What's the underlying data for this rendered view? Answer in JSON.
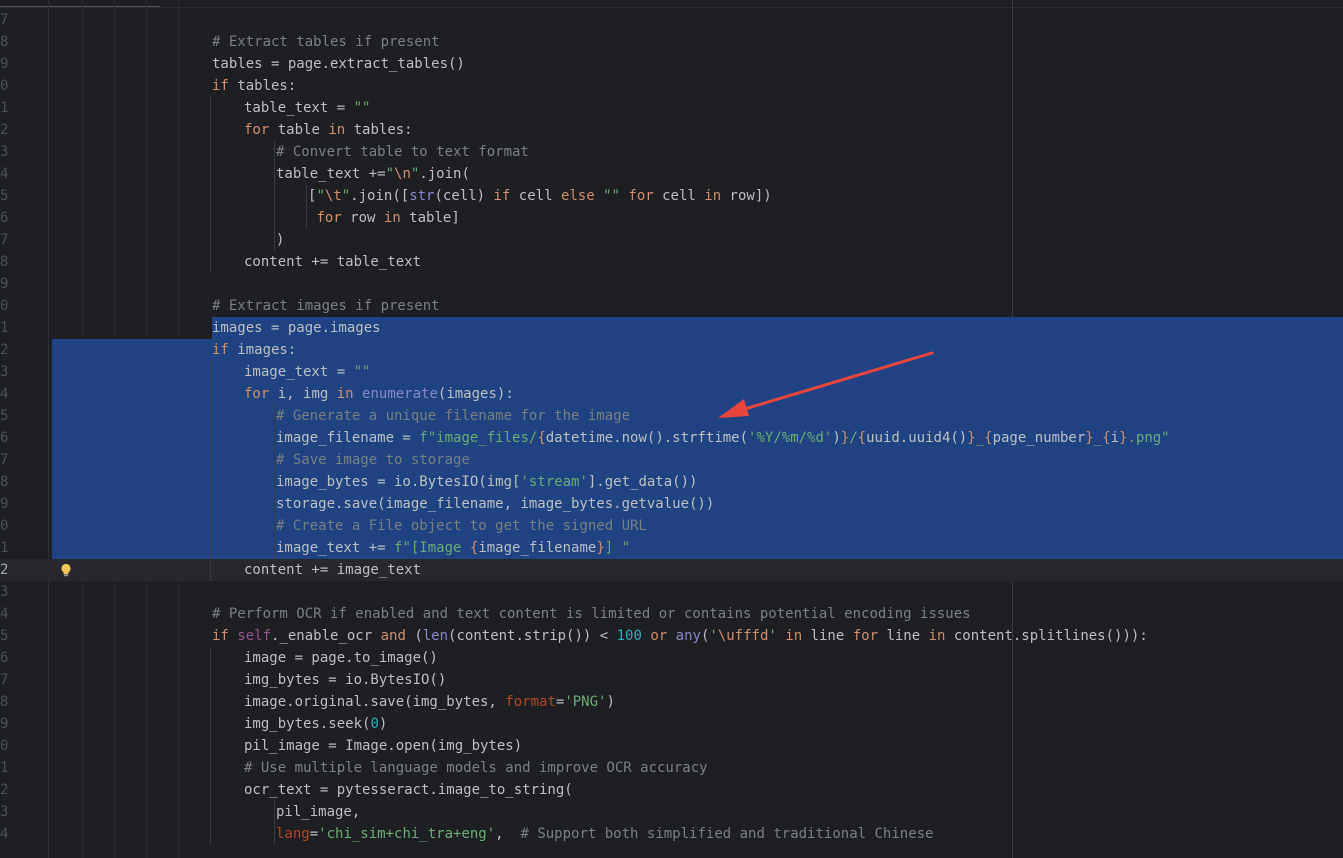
{
  "colors": {
    "background": "#1e1f22",
    "selection": "#214283",
    "current_line": "#26282e",
    "line_number": "#4b5059",
    "keyword": "#cf8e6d",
    "string": "#6aab73",
    "comment": "#7a7e85",
    "number": "#2aacb8",
    "builtin": "#8888c6",
    "self": "#94558d",
    "named_arg": "#aa4926",
    "text": "#bcbec4",
    "escape": "#cf8e6d",
    "arrow": "#e8453c"
  },
  "icons": {
    "intention_bulb": "lightbulb-icon",
    "annotation": "red-arrow"
  },
  "editor": {
    "language": "python",
    "selection_lines": [
      31,
      32
    ],
    "current_line": 42,
    "lines": [
      {
        "n": "7",
        "indent": 0,
        "tokens": []
      },
      {
        "n": "8",
        "indent": 2,
        "tokens": [
          {
            "t": "# Extract tables if present",
            "k": "cm"
          }
        ]
      },
      {
        "n": "9",
        "indent": 2,
        "tokens": [
          {
            "t": "tables = page.extract_tables()",
            "k": ""
          }
        ]
      },
      {
        "n": "0",
        "indent": 2,
        "tokens": [
          {
            "t": "if",
            "k": "kw"
          },
          {
            "t": " tables:",
            "k": ""
          }
        ]
      },
      {
        "n": "1",
        "indent": 3,
        "tokens": [
          {
            "t": "table_text = ",
            "k": ""
          },
          {
            "t": "\"\"",
            "k": "str"
          }
        ]
      },
      {
        "n": "2",
        "indent": 3,
        "tokens": [
          {
            "t": "for",
            "k": "kw"
          },
          {
            "t": " table ",
            "k": ""
          },
          {
            "t": "in",
            "k": "kw"
          },
          {
            "t": " tables:",
            "k": ""
          }
        ]
      },
      {
        "n": "3",
        "indent": 4,
        "tokens": [
          {
            "t": "# Convert table to text format",
            "k": "cm"
          }
        ]
      },
      {
        "n": "4",
        "indent": 4,
        "tokens": [
          {
            "t": "table_text +=",
            "k": ""
          },
          {
            "t": "\"",
            "k": "str"
          },
          {
            "t": "\\n",
            "k": "esc"
          },
          {
            "t": "\"",
            "k": "str"
          },
          {
            "t": ".join(",
            "k": ""
          }
        ]
      },
      {
        "n": "5",
        "indent": 5,
        "tokens": [
          {
            "t": "[",
            "k": ""
          },
          {
            "t": "\"",
            "k": "str"
          },
          {
            "t": "\\t",
            "k": "esc"
          },
          {
            "t": "\"",
            "k": "str"
          },
          {
            "t": ".join([",
            "k": ""
          },
          {
            "t": "str",
            "k": "bi"
          },
          {
            "t": "(cell) ",
            "k": ""
          },
          {
            "t": "if",
            "k": "kw"
          },
          {
            "t": " cell ",
            "k": ""
          },
          {
            "t": "else",
            "k": "kw"
          },
          {
            "t": " ",
            "k": ""
          },
          {
            "t": "\"\"",
            "k": "str"
          },
          {
            "t": " ",
            "k": ""
          },
          {
            "t": "for",
            "k": "kw"
          },
          {
            "t": " cell ",
            "k": ""
          },
          {
            "t": "in",
            "k": "kw"
          },
          {
            "t": " row])",
            "k": ""
          }
        ]
      },
      {
        "n": "6",
        "indent": 5,
        "tokens": [
          {
            "t": " ",
            "k": ""
          },
          {
            "t": "for",
            "k": "kw"
          },
          {
            "t": " row ",
            "k": ""
          },
          {
            "t": "in",
            "k": "kw"
          },
          {
            "t": " table]",
            "k": ""
          }
        ]
      },
      {
        "n": "7",
        "indent": 4,
        "tokens": [
          {
            "t": ")",
            "k": ""
          }
        ]
      },
      {
        "n": "8",
        "indent": 3,
        "tokens": [
          {
            "t": "content += table_text",
            "k": ""
          }
        ]
      },
      {
        "n": "9",
        "indent": 0,
        "tokens": []
      },
      {
        "n": "0",
        "indent": 2,
        "tokens": [
          {
            "t": "# Extract images if present",
            "k": "cm"
          }
        ]
      },
      {
        "n": "1",
        "indent": 2,
        "tokens": [
          {
            "t": "images = page.images",
            "k": ""
          }
        ]
      },
      {
        "n": "2",
        "indent": 2,
        "tokens": [
          {
            "t": "if",
            "k": "kw"
          },
          {
            "t": " images:",
            "k": ""
          }
        ]
      },
      {
        "n": "3",
        "indent": 3,
        "tokens": [
          {
            "t": "image_text = ",
            "k": ""
          },
          {
            "t": "\"\"",
            "k": "str"
          }
        ]
      },
      {
        "n": "4",
        "indent": 3,
        "tokens": [
          {
            "t": "for",
            "k": "kw"
          },
          {
            "t": " i, img ",
            "k": ""
          },
          {
            "t": "in",
            "k": "kw"
          },
          {
            "t": " ",
            "k": ""
          },
          {
            "t": "enumerate",
            "k": "bi"
          },
          {
            "t": "(images):",
            "k": ""
          }
        ]
      },
      {
        "n": "5",
        "indent": 4,
        "tokens": [
          {
            "t": "# Generate a unique filename for the image",
            "k": "cm"
          }
        ]
      },
      {
        "n": "6",
        "indent": 4,
        "tokens": [
          {
            "t": "image_filename = ",
            "k": ""
          },
          {
            "t": "f\"image_files/",
            "k": "str"
          },
          {
            "t": "{",
            "k": "esc"
          },
          {
            "t": "datetime.now().strftime(",
            "k": ""
          },
          {
            "t": "'%Y/%m/%d'",
            "k": "str"
          },
          {
            "t": ")",
            "k": ""
          },
          {
            "t": "}",
            "k": "esc"
          },
          {
            "t": "/",
            "k": "str"
          },
          {
            "t": "{",
            "k": "esc"
          },
          {
            "t": "uuid.uuid4()",
            "k": ""
          },
          {
            "t": "}",
            "k": "esc"
          },
          {
            "t": "_",
            "k": "str"
          },
          {
            "t": "{",
            "k": "esc"
          },
          {
            "t": "page_number",
            "k": ""
          },
          {
            "t": "}",
            "k": "esc"
          },
          {
            "t": "_",
            "k": "str"
          },
          {
            "t": "{",
            "k": "esc"
          },
          {
            "t": "i",
            "k": ""
          },
          {
            "t": "}",
            "k": "esc"
          },
          {
            "t": ".png\"",
            "k": "str"
          }
        ]
      },
      {
        "n": "7",
        "indent": 4,
        "tokens": [
          {
            "t": "# Save image to storage",
            "k": "cm"
          }
        ]
      },
      {
        "n": "8",
        "indent": 4,
        "tokens": [
          {
            "t": "image_bytes = io.BytesIO(img[",
            "k": ""
          },
          {
            "t": "'stream'",
            "k": "str"
          },
          {
            "t": "].get_data())",
            "k": ""
          }
        ]
      },
      {
        "n": "9",
        "indent": 4,
        "tokens": [
          {
            "t": "storage.save(image_filename, image_bytes.getvalue())",
            "k": ""
          }
        ]
      },
      {
        "n": "0",
        "indent": 4,
        "tokens": [
          {
            "t": "# Create a File object to get the signed URL",
            "k": "cm"
          }
        ]
      },
      {
        "n": "1",
        "indent": 4,
        "tokens": [
          {
            "t": "image_text += ",
            "k": ""
          },
          {
            "t": "f\"[Image ",
            "k": "str"
          },
          {
            "t": "{",
            "k": "esc"
          },
          {
            "t": "image_filename",
            "k": ""
          },
          {
            "t": "}",
            "k": "esc"
          },
          {
            "t": "] \"",
            "k": "str"
          }
        ]
      },
      {
        "n": "2",
        "indent": 3,
        "tokens": [
          {
            "t": "content += image_text",
            "k": ""
          }
        ]
      },
      {
        "n": "3",
        "indent": 0,
        "tokens": []
      },
      {
        "n": "4",
        "indent": 2,
        "tokens": [
          {
            "t": "# Perform OCR if enabled and text content is limited or contains potential encoding issues",
            "k": "cm"
          }
        ]
      },
      {
        "n": "5",
        "indent": 2,
        "tokens": [
          {
            "t": "if",
            "k": "kw"
          },
          {
            "t": " ",
            "k": ""
          },
          {
            "t": "self",
            "k": "self"
          },
          {
            "t": "._enable_ocr ",
            "k": ""
          },
          {
            "t": "and",
            "k": "kw"
          },
          {
            "t": " (",
            "k": ""
          },
          {
            "t": "len",
            "k": "bi"
          },
          {
            "t": "(content.strip()) < ",
            "k": ""
          },
          {
            "t": "100",
            "k": "num"
          },
          {
            "t": " ",
            "k": ""
          },
          {
            "t": "or",
            "k": "kw"
          },
          {
            "t": " ",
            "k": ""
          },
          {
            "t": "any",
            "k": "bi"
          },
          {
            "t": "(",
            "k": ""
          },
          {
            "t": "'",
            "k": "str"
          },
          {
            "t": "\\ufffd",
            "k": "esc"
          },
          {
            "t": "'",
            "k": "str"
          },
          {
            "t": " ",
            "k": ""
          },
          {
            "t": "in",
            "k": "kw"
          },
          {
            "t": " line ",
            "k": ""
          },
          {
            "t": "for",
            "k": "kw"
          },
          {
            "t": " line ",
            "k": ""
          },
          {
            "t": "in",
            "k": "kw"
          },
          {
            "t": " content.splitlines())):",
            "k": ""
          }
        ]
      },
      {
        "n": "6",
        "indent": 3,
        "tokens": [
          {
            "t": "image = page.to_image()",
            "k": ""
          }
        ]
      },
      {
        "n": "7",
        "indent": 3,
        "tokens": [
          {
            "t": "img_bytes = io.BytesIO()",
            "k": ""
          }
        ]
      },
      {
        "n": "8",
        "indent": 3,
        "tokens": [
          {
            "t": "image.original.save(img_bytes, ",
            "k": ""
          },
          {
            "t": "format",
            "k": "arg"
          },
          {
            "t": "=",
            "k": ""
          },
          {
            "t": "'PNG'",
            "k": "str"
          },
          {
            "t": ")",
            "k": ""
          }
        ]
      },
      {
        "n": "9",
        "indent": 3,
        "tokens": [
          {
            "t": "img_bytes.seek(",
            "k": ""
          },
          {
            "t": "0",
            "k": "num"
          },
          {
            "t": ")",
            "k": ""
          }
        ]
      },
      {
        "n": "0",
        "indent": 3,
        "tokens": [
          {
            "t": "pil_image = Image.open(img_bytes)",
            "k": ""
          }
        ]
      },
      {
        "n": "1",
        "indent": 3,
        "tokens": [
          {
            "t": "# Use multiple language models and improve OCR accuracy",
            "k": "cm"
          }
        ]
      },
      {
        "n": "2",
        "indent": 3,
        "tokens": [
          {
            "t": "ocr_text = pytesseract.image_to_string(",
            "k": ""
          }
        ]
      },
      {
        "n": "3",
        "indent": 4,
        "tokens": [
          {
            "t": "pil_image,",
            "k": ""
          }
        ]
      },
      {
        "n": "4",
        "indent": 4,
        "tokens": [
          {
            "t": "lang",
            "k": "arg"
          },
          {
            "t": "=",
            "k": ""
          },
          {
            "t": "'chi_sim+chi_tra+eng'",
            "k": "str"
          },
          {
            "t": ",  ",
            "k": ""
          },
          {
            "t": "# Support both simplified and traditional Chinese",
            "k": "cm"
          }
        ]
      }
    ]
  }
}
